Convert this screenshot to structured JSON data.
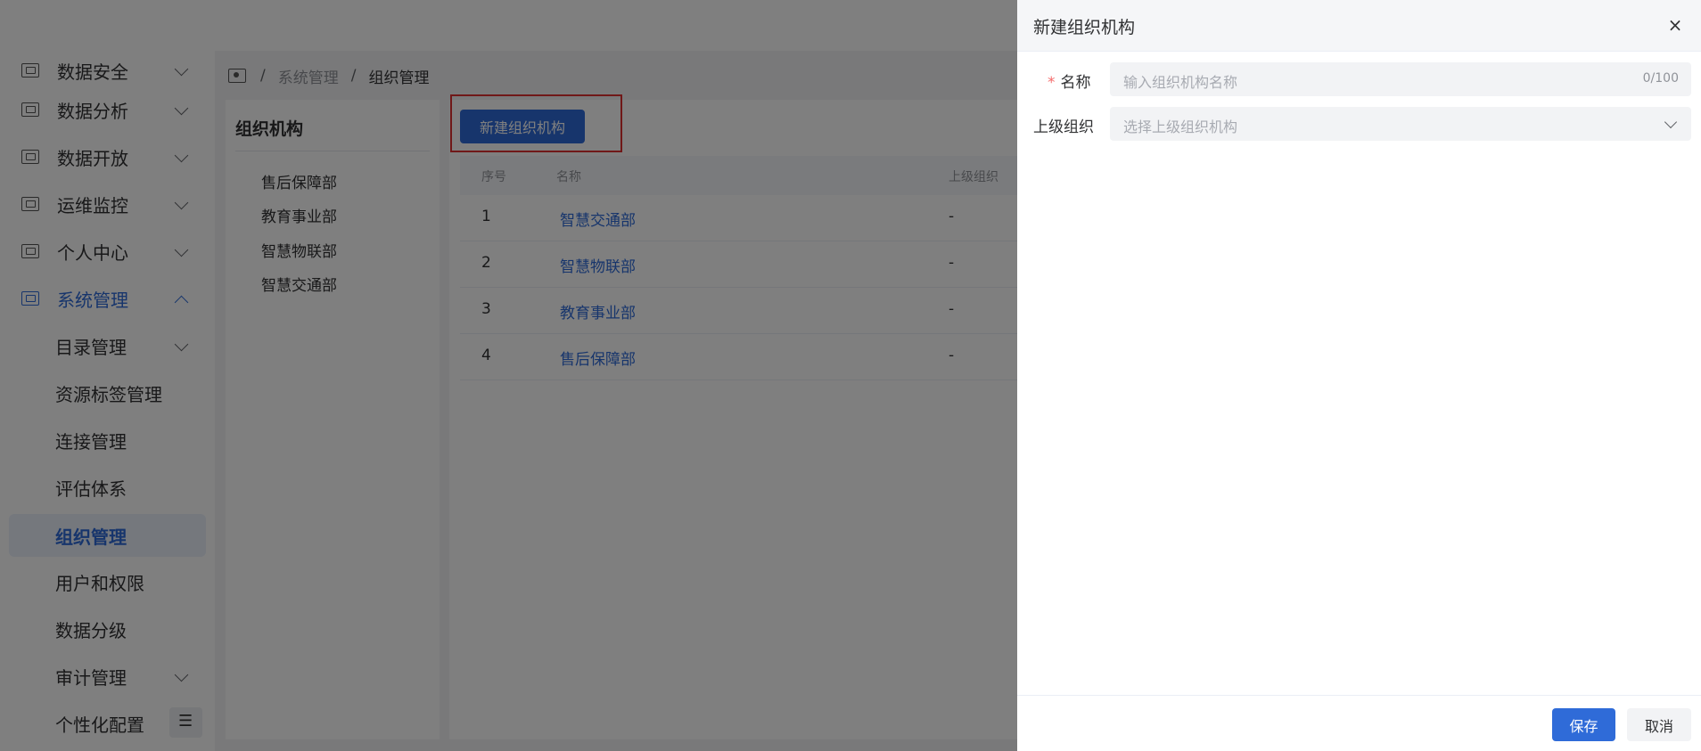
{
  "sidebar": {
    "items": [
      {
        "label": "数据安全",
        "icon": "shield-icon"
      },
      {
        "label": "数据分析",
        "icon": "analysis-icon"
      },
      {
        "label": "数据开放",
        "icon": "open-data-icon"
      },
      {
        "label": "运维监控",
        "icon": "monitor-icon"
      },
      {
        "label": "个人中心",
        "icon": "user-center-icon"
      },
      {
        "label": "系统管理",
        "icon": "system-icon"
      }
    ],
    "sub_items": [
      {
        "label": "目录管理"
      },
      {
        "label": "资源标签管理"
      },
      {
        "label": "连接管理"
      },
      {
        "label": "评估体系"
      },
      {
        "label": "组织管理"
      },
      {
        "label": "用户和权限"
      },
      {
        "label": "数据分级"
      },
      {
        "label": "审计管理"
      },
      {
        "label": "个性化配置"
      }
    ]
  },
  "breadcrumb": {
    "sep": "/",
    "level1": "系统管理",
    "current": "组织管理"
  },
  "tree": {
    "title": "组织机构",
    "nodes": [
      "售后保障部",
      "教育事业部",
      "智慧物联部",
      "智慧交通部"
    ]
  },
  "main": {
    "new_button": "新建组织机构",
    "columns": [
      "序号",
      "名称",
      "上级组织"
    ],
    "rows": [
      {
        "index": "1",
        "name": "智慧交通部",
        "parent": "-"
      },
      {
        "index": "2",
        "name": "智慧物联部",
        "parent": "-"
      },
      {
        "index": "3",
        "name": "教育事业部",
        "parent": "-"
      },
      {
        "index": "4",
        "name": "售后保障部",
        "parent": "-"
      }
    ]
  },
  "drawer": {
    "title": "新建组织机构",
    "close": "×",
    "name_required": "*",
    "name_label": "名称",
    "name_placeholder": "输入组织机构名称",
    "name_count": "0/100",
    "parent_label": "上级组织",
    "parent_placeholder": "选择上级组织机构",
    "save": "保存",
    "cancel": "取消"
  },
  "colors": {
    "accent": "#2f6bd8",
    "highlight": "#e03030",
    "required": "#f56c6c"
  }
}
